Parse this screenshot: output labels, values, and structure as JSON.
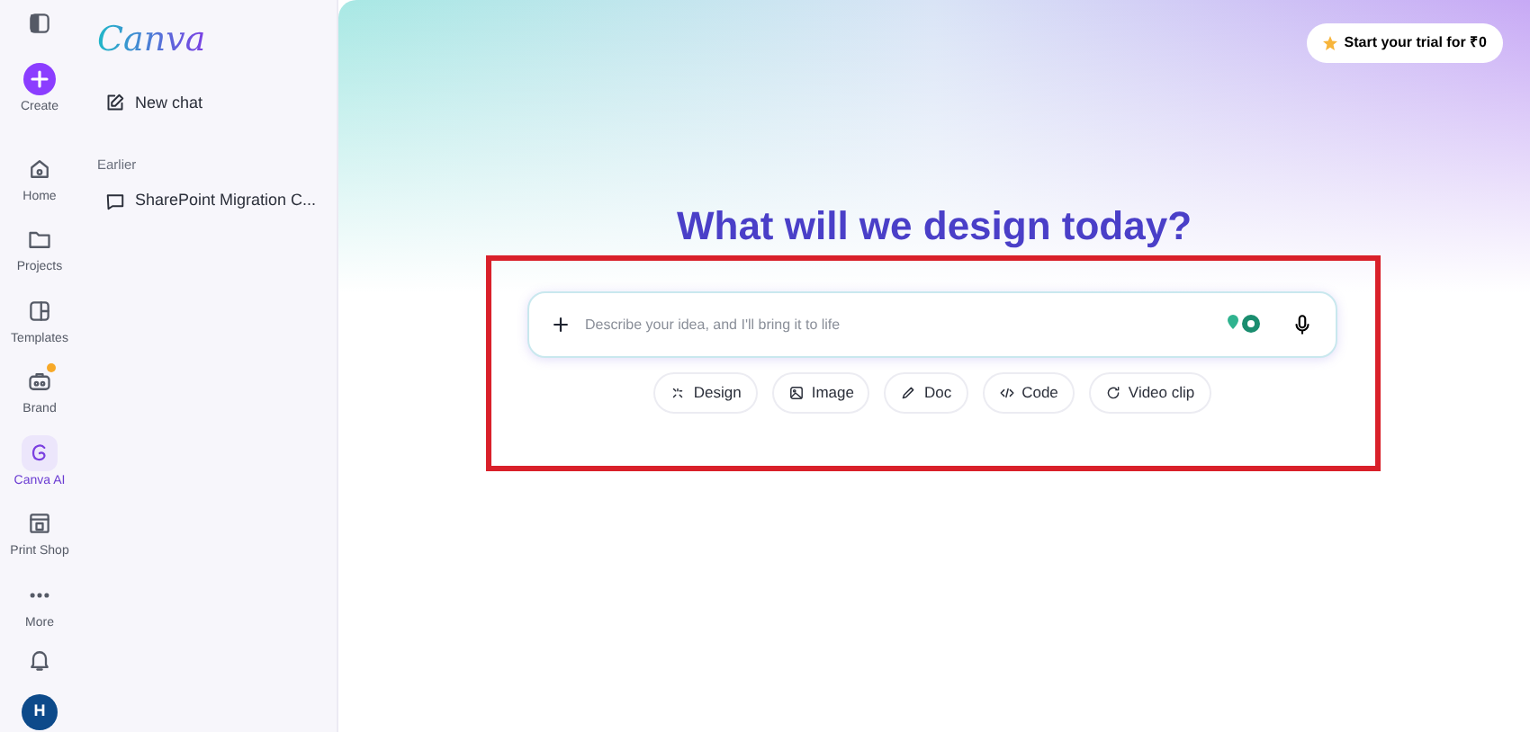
{
  "rail": {
    "items": [
      {
        "kind": "create",
        "label": "Create",
        "selected": false,
        "badge": false
      },
      {
        "kind": "home",
        "label": "Home",
        "selected": false,
        "badge": false
      },
      {
        "kind": "projects",
        "label": "Projects",
        "selected": false,
        "badge": false
      },
      {
        "kind": "templates",
        "label": "Templates",
        "selected": false,
        "badge": false
      },
      {
        "kind": "brand",
        "label": "Brand",
        "selected": false,
        "badge": true
      },
      {
        "kind": "ai",
        "label": "Canva AI",
        "selected": true,
        "badge": false
      },
      {
        "kind": "print",
        "label": "Print Shop",
        "selected": false,
        "badge": false
      },
      {
        "kind": "more",
        "label": "More",
        "selected": false,
        "badge": false
      }
    ],
    "avatar": "H"
  },
  "panel": {
    "logo": "Canva",
    "new_chat": "New chat",
    "section": "Earlier",
    "chats": [
      "SharePoint Migration C..."
    ]
  },
  "trial_button": "Start your trial for ₹0",
  "heading": "What will we design today?",
  "prompt": {
    "placeholder": "Describe your idea, and I'll bring it to life",
    "highlighted": true
  },
  "chips": [
    {
      "kind": "design",
      "label": "Design"
    },
    {
      "kind": "image",
      "label": "Image"
    },
    {
      "kind": "doc",
      "label": "Doc"
    },
    {
      "kind": "code",
      "label": "Code"
    },
    {
      "kind": "video",
      "label": "Video clip"
    }
  ]
}
